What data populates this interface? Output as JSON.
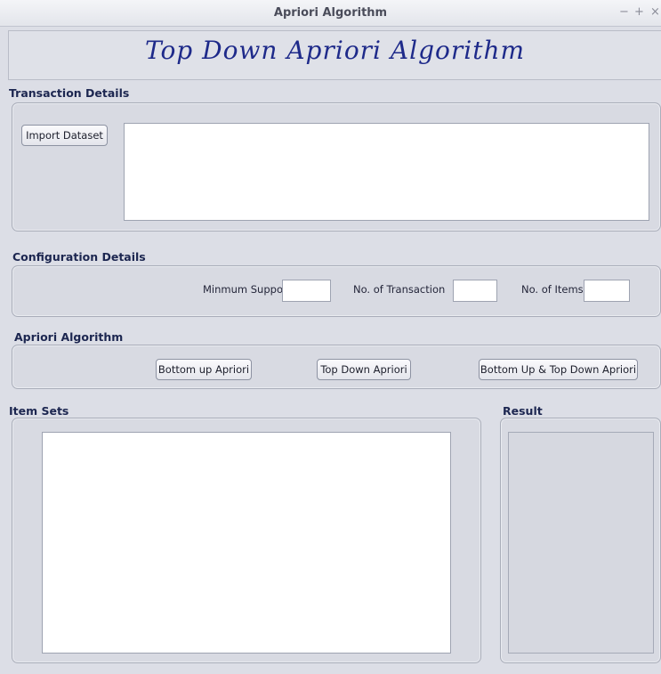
{
  "window": {
    "title": "Apriori Algorithm",
    "controls": {
      "minimize": "−",
      "maximize": "+",
      "close": "×"
    }
  },
  "header": {
    "heading": "Top Down Apriori Algorithm"
  },
  "transaction": {
    "section_label": "Transaction Details",
    "import_label": "Import Dataset",
    "dataset_text": ""
  },
  "config": {
    "section_label": "Configuration Details",
    "min_support_label": "Minmum Support",
    "min_support_value": "",
    "num_transaction_label": "No. of Transaction",
    "num_transaction_value": "",
    "num_items_label": "No. of Items",
    "num_items_value": ""
  },
  "algorithm": {
    "section_label": "Apriori Algorithm",
    "bottom_up_label": "Bottom up Apriori",
    "top_down_label": "Top Down Apriori",
    "both_label": "Bottom Up  & Top Down Apriori"
  },
  "item_sets": {
    "section_label": "Item Sets",
    "text": ""
  },
  "result": {
    "section_label": "Result",
    "text": ""
  }
}
